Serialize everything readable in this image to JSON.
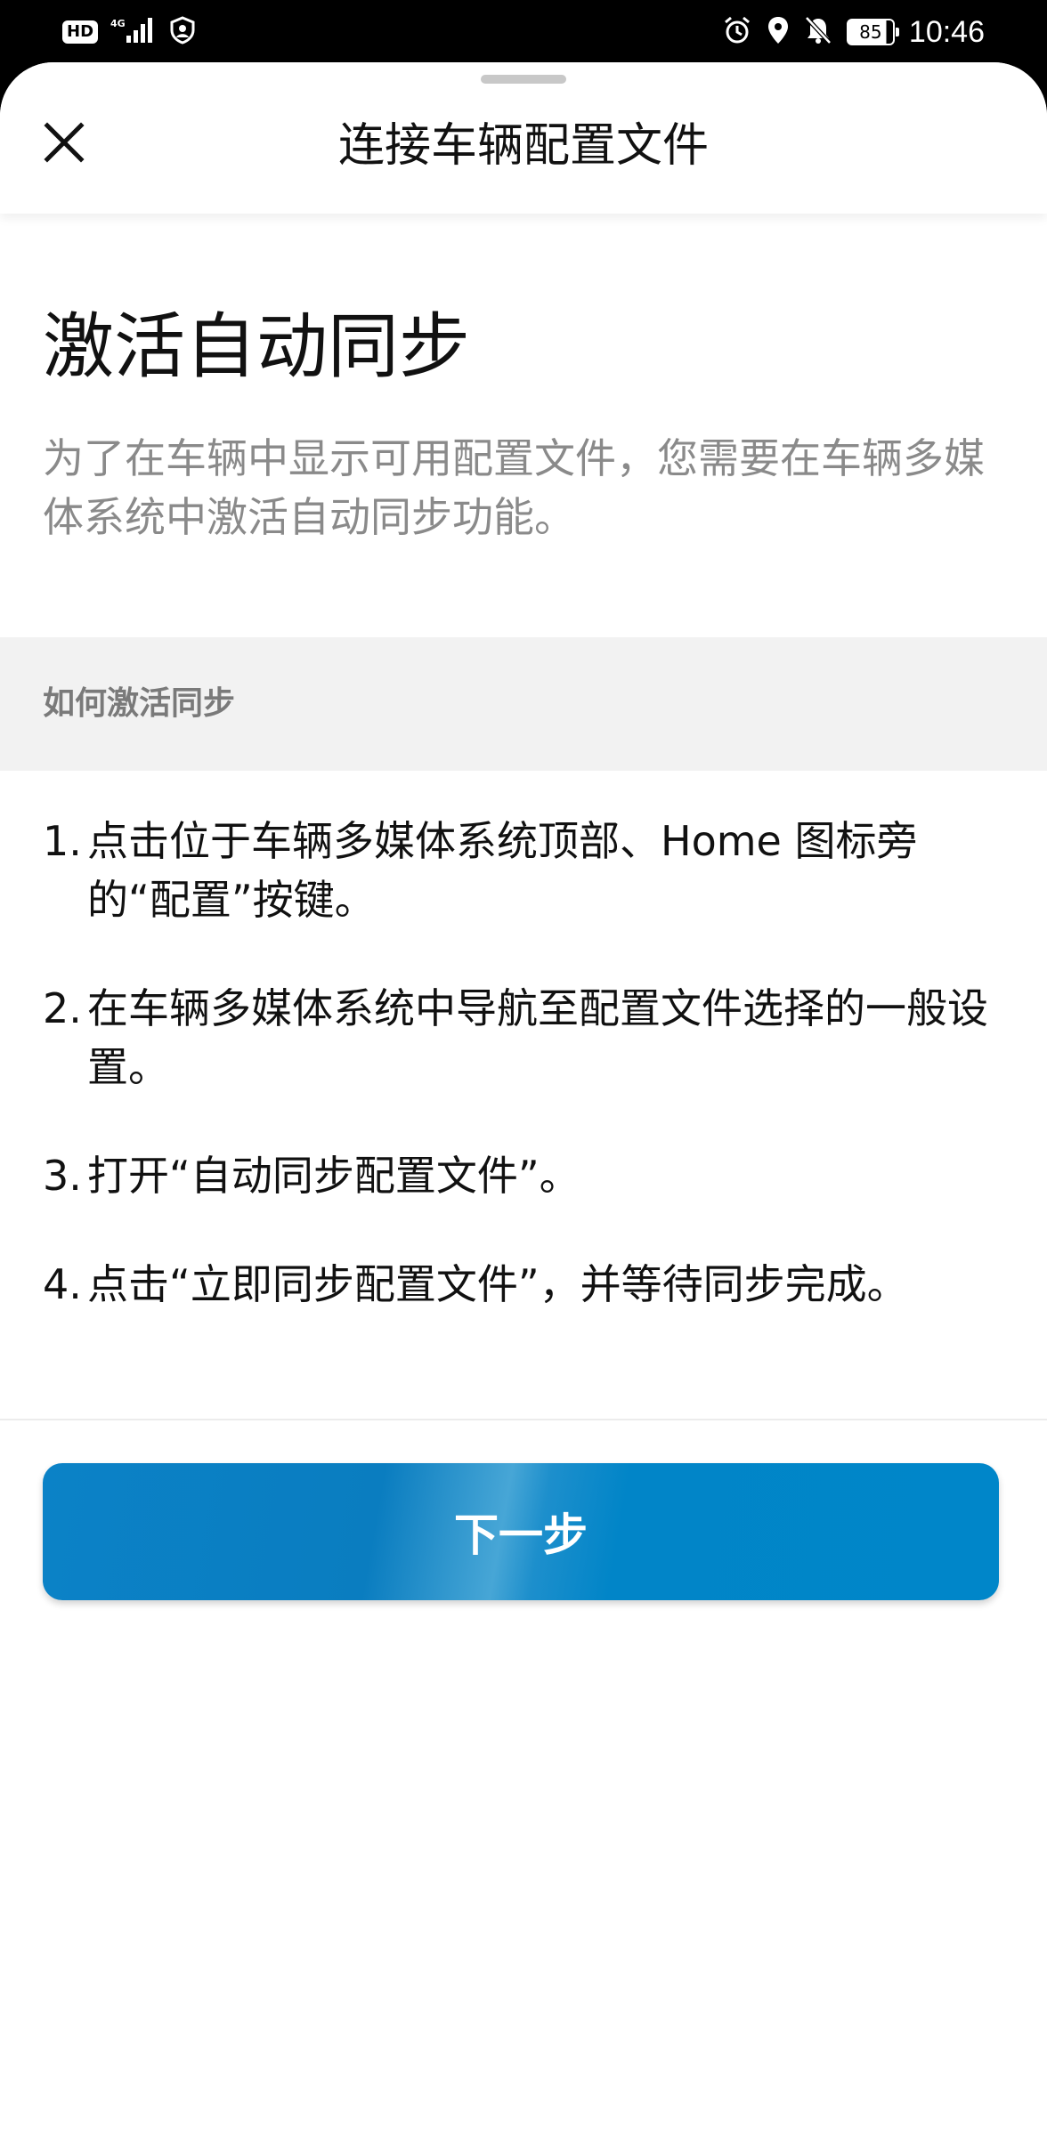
{
  "status_bar": {
    "network_badge": "HD",
    "signal": "4G",
    "battery": "85",
    "time": "10:46"
  },
  "header": {
    "title": "连接车辆配置文件"
  },
  "main": {
    "title": "激活自动同步",
    "description": "为了在车辆中显示可用配置文件，您需要在车辆多媒体系统中激活自动同步功能。"
  },
  "section": {
    "label": "如何激活同步"
  },
  "steps": [
    {
      "number": "1.",
      "text": "点击位于车辆多媒体系统顶部、Home 图标旁的“配置”按键。"
    },
    {
      "number": "2.",
      "text": "在车辆多媒体系统中导航至配置文件选择的一般设置。"
    },
    {
      "number": "3.",
      "text": "打开“自动同步配置文件”。"
    },
    {
      "number": "4.",
      "text": "点击“立即同步配置文件”，并等待同步完成。"
    }
  ],
  "footer": {
    "next_label": "下一步"
  },
  "colors": {
    "accent": "#0086C9",
    "description_text": "#8A8A8A",
    "section_band": "#F2F2F2"
  }
}
